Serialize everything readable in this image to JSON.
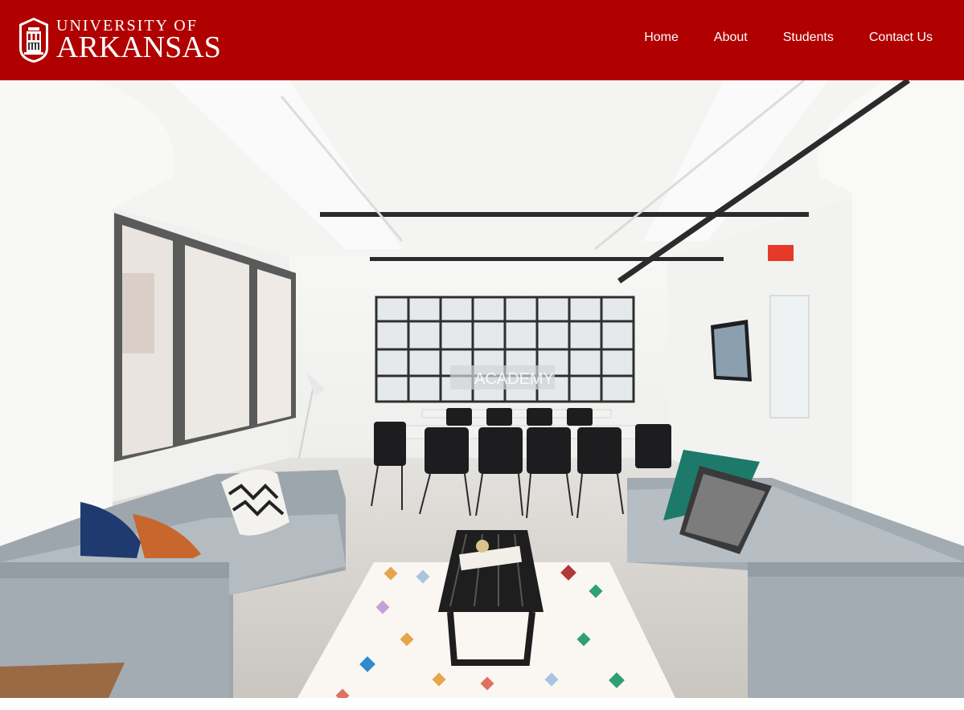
{
  "header": {
    "brand_color": "#b00000",
    "logo": {
      "line1": "UNIVERSITY OF",
      "line2": "ARKANSAS"
    },
    "nav": [
      {
        "label": "Home"
      },
      {
        "label": "About"
      },
      {
        "label": "Students"
      },
      {
        "label": "Contact Us"
      }
    ]
  },
  "hero": {
    "image": "office-lounge-photo",
    "window_sign": "ACADEMY"
  }
}
